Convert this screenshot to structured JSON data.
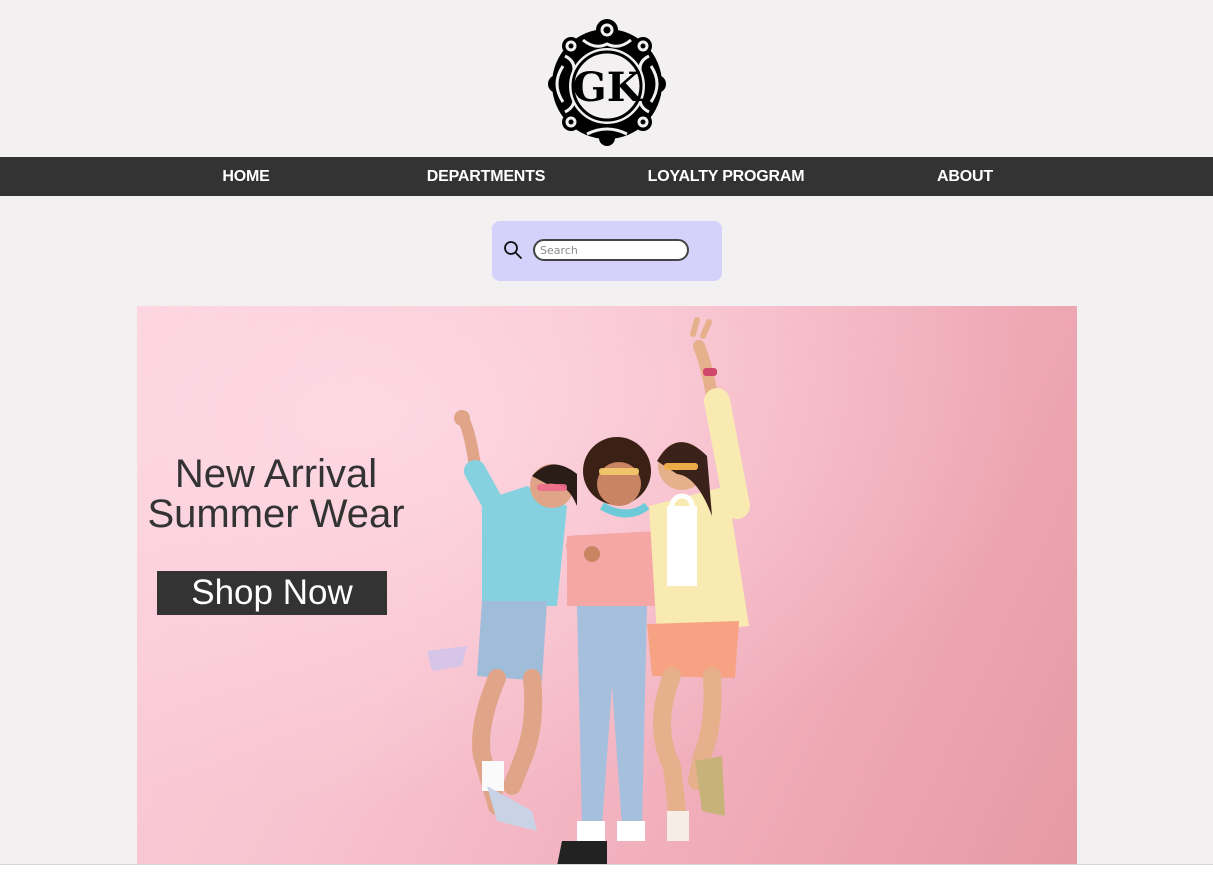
{
  "brand": {
    "logo_text": "GK",
    "logo_icon": "ornate-gk-monogram"
  },
  "nav": {
    "items": [
      {
        "label": "Home"
      },
      {
        "label": "Departments"
      },
      {
        "label": "Loyalty Program"
      },
      {
        "label": "About"
      }
    ]
  },
  "search": {
    "placeholder": "Search",
    "value": "",
    "icon": "search-icon"
  },
  "hero": {
    "heading_line1": "New Arrival",
    "heading_line2": "Summer Wear",
    "cta_label": "Shop Now",
    "image_subject": "three-friends-summer-outfits"
  },
  "colors": {
    "page_bg": "#f2f0f1",
    "nav_bg": "#333333",
    "nav_text": "#ffffff",
    "search_panel_bg": "#d4d1fb",
    "hero_bg": "#f8c2cf",
    "cta_bg": "#333333",
    "cta_text": "#ffffff",
    "heading_text": "#333333"
  }
}
